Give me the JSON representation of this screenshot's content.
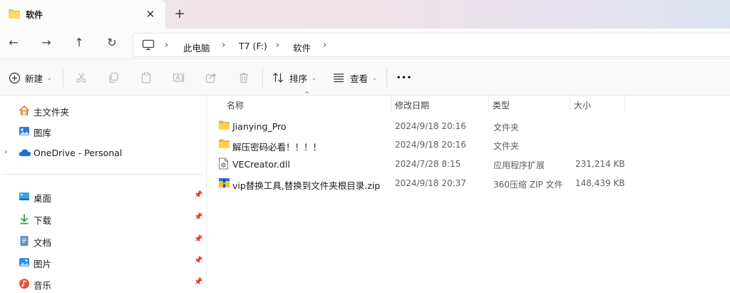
{
  "tab": {
    "title": "软件",
    "close_glyph": "✕",
    "new_tab_glyph": "+"
  },
  "nav": {
    "back_glyph": "←",
    "forward_glyph": "→",
    "up_glyph": "↑",
    "refresh_glyph": "↻",
    "breadcrumbs": [
      "此电脑",
      "T7 (F:)",
      "软件"
    ],
    "chevron_glyph": "›"
  },
  "toolbar": {
    "new_label": "新建",
    "sort_label": "排序",
    "view_label": "查看",
    "more_glyph": "•••",
    "dropdown_glyph": "⌄",
    "icons": [
      "cut-icon",
      "copy-icon",
      "paste-icon",
      "rename-icon",
      "share-icon",
      "delete-icon"
    ]
  },
  "sidebar": {
    "items": [
      {
        "label": "主文件夹",
        "icon": "home-icon",
        "pinned": false
      },
      {
        "label": "图库",
        "icon": "gallery-icon",
        "pinned": false
      },
      {
        "label": "OneDrive - Personal",
        "icon": "cloud-icon",
        "pinned": false,
        "expandable": true
      },
      {
        "label": "桌面",
        "icon": "desktop-icon",
        "pinned": true
      },
      {
        "label": "下载",
        "icon": "download-icon",
        "pinned": true
      },
      {
        "label": "文档",
        "icon": "documents-icon",
        "pinned": true
      },
      {
        "label": "图片",
        "icon": "pictures-icon",
        "pinned": true
      },
      {
        "label": "音乐",
        "icon": "music-icon",
        "pinned": true
      }
    ],
    "expand_glyph": "›",
    "pin_glyph": "📌"
  },
  "list": {
    "columns": {
      "name": "名称",
      "date": "修改日期",
      "type": "类型",
      "size": "大小"
    },
    "sort_glyph": "^",
    "rows": [
      {
        "name": "Jianying_Pro",
        "date": "2024/9/18 20:16",
        "type": "文件夹",
        "size": "",
        "icon": "folder-icon"
      },
      {
        "name": "解压密码必看！！！！",
        "date": "2024/9/18 20:16",
        "type": "文件夹",
        "size": "",
        "icon": "folder-icon"
      },
      {
        "name": "VECreator.dll",
        "date": "2024/7/28 8:15",
        "type": "应用程序扩展",
        "size": "231,214 KB",
        "icon": "dll-file-icon"
      },
      {
        "name": "vip替换工具,替换到文件夹根目录.zip",
        "date": "2024/9/18 20:37",
        "type": "360压缩 ZIP 文件",
        "size": "148,439 KB",
        "icon": "zip-file-icon"
      }
    ]
  },
  "colors": {
    "folder": "#f3c74f",
    "accent": "#0067c0",
    "tab_bg": "#fbfbfb"
  }
}
